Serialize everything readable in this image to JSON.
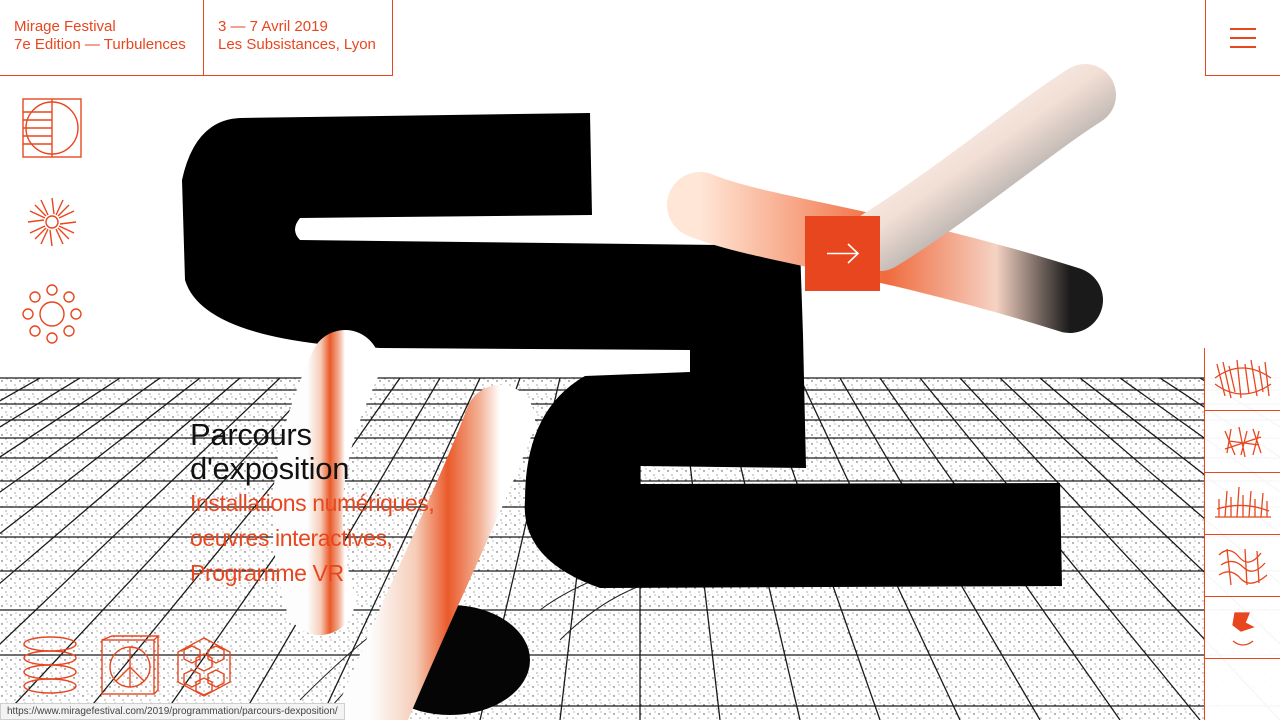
{
  "header": {
    "festival_name": "Mirage Festival",
    "edition": "7e Edition — Turbulences",
    "dates": "3 — 7 Avril 2019",
    "venue": "Les Subsistances, Lyon"
  },
  "menu": {
    "icon": "hamburger-menu-icon"
  },
  "left_nav": {
    "icons": [
      "circle-grid-icon",
      "spiral-burst-icon",
      "ring-of-circles-icon"
    ]
  },
  "hero": {
    "title_line1": "Parcours",
    "title_line2": "d'exposition",
    "sub_line1": "Installations numériques,",
    "sub_line2": "oeuvres interactives,",
    "sub_line3": "Programme VR"
  },
  "arrow_button": {
    "icon": "arrow-right-icon"
  },
  "bottom_nav": {
    "icons": [
      "stacked-rings-icon",
      "cube-peace-icon",
      "hexagon-cluster-icon"
    ]
  },
  "right_rail": {
    "icons": [
      "scribble-pattern-1-icon",
      "scribble-pattern-2-icon",
      "scribble-pattern-3-icon",
      "scribble-pattern-4-icon",
      "scribble-pattern-5-icon"
    ]
  },
  "status": {
    "url": "https://www.miragefestival.com/2019/programmation/parcours-dexposition/"
  },
  "colors": {
    "accent": "#e8461f",
    "ink": "#111111",
    "background": "#ffffff"
  }
}
